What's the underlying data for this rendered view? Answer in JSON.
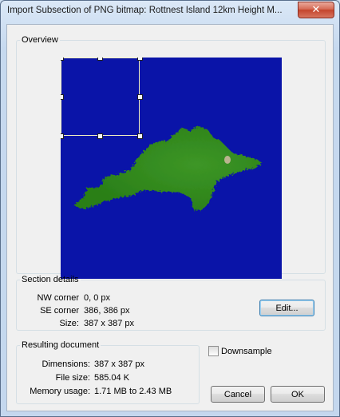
{
  "window": {
    "title": "Import Subsection of PNG bitmap: Rottnest Island 12km Height M...",
    "close_glyph": "✕"
  },
  "overview": {
    "legend": "Overview"
  },
  "section_details": {
    "legend": "Section details",
    "nw_label": "NW corner",
    "nw_value": "0, 0 px",
    "se_label": "SE corner",
    "se_value": "386, 386 px",
    "size_label": "Size:",
    "size_value": "387 x 387 px",
    "edit_button": "Edit..."
  },
  "resulting": {
    "legend": "Resulting document",
    "dim_label": "Dimensions:",
    "dim_value": "387 x 387 px",
    "file_label": "File size:",
    "file_value": "585.04 K",
    "mem_label": "Memory usage:",
    "mem_value": "1.71 MB to 2.43 MB"
  },
  "downsample": {
    "label": "Downsample",
    "checked": false
  },
  "buttons": {
    "cancel": "Cancel",
    "ok": "OK"
  },
  "colors": {
    "sea": "#0a14a8",
    "land": "#2f8a1c",
    "selection": "#f3f0c0"
  }
}
